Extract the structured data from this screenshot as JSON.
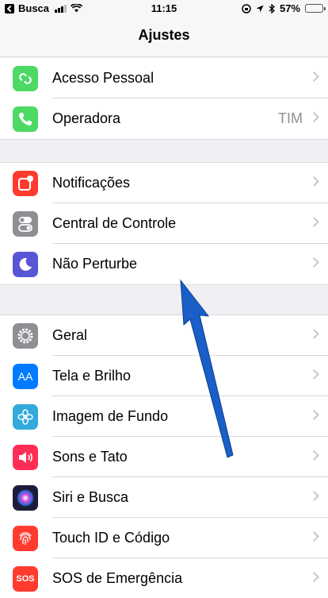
{
  "status_bar": {
    "back_app": "Busca",
    "time": "11:15",
    "battery": "57%",
    "battery_level": 0.57
  },
  "nav": {
    "title": "Ajustes"
  },
  "groups": [
    {
      "items": [
        {
          "label": "Acesso Pessoal",
          "icon": "hotspot-icon",
          "color": "#4cd964"
        },
        {
          "label": "Operadora",
          "value": "TIM",
          "icon": "phone-icon",
          "color": "#4cd964"
        }
      ]
    },
    {
      "items": [
        {
          "label": "Notificações",
          "icon": "notifications-icon",
          "color": "#ff3b30"
        },
        {
          "label": "Central de Controle",
          "icon": "control-center-icon",
          "color": "#8e8e93"
        },
        {
          "label": "Não Perturbe",
          "icon": "moon-icon",
          "color": "#5856d6"
        }
      ]
    },
    {
      "items": [
        {
          "label": "Geral",
          "icon": "gear-icon",
          "color": "#8e8e93"
        },
        {
          "label": "Tela e Brilho",
          "icon": "display-icon",
          "glyph": "AA",
          "color": "#007aff"
        },
        {
          "label": "Imagem de Fundo",
          "icon": "wallpaper-icon",
          "color": "#34aadc"
        },
        {
          "label": "Sons e Tato",
          "icon": "sound-icon",
          "color": "#ff2d55"
        },
        {
          "label": "Siri e Busca",
          "icon": "siri-icon",
          "color": "#1c1c3a"
        },
        {
          "label": "Touch ID e Código",
          "icon": "fingerprint-icon",
          "color": "#ff3b30"
        },
        {
          "label": "SOS de Emergência",
          "icon": "sos-icon",
          "glyph": "SOS",
          "color": "#ff3b30"
        }
      ]
    }
  ],
  "annotation": {
    "color": "#1a5ec7"
  }
}
